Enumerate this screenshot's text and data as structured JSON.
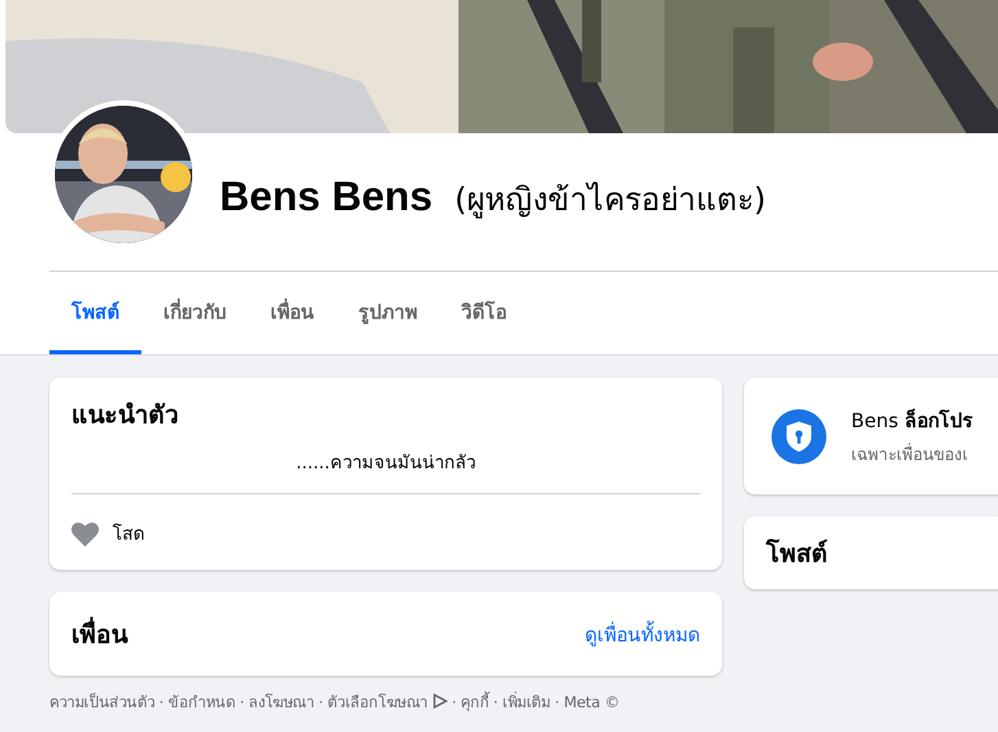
{
  "profile": {
    "name": "Bens Bens",
    "alternate_name": "(ผูหญิงข้าไครอย่าแตะ)"
  },
  "tabs": [
    {
      "label": "โพสต์",
      "selected": true
    },
    {
      "label": "เกี่ยวกับ",
      "selected": false
    },
    {
      "label": "เพื่อน",
      "selected": false
    },
    {
      "label": "รูปภาพ",
      "selected": false
    },
    {
      "label": "วิดีโอ",
      "selected": false
    }
  ],
  "intro": {
    "title": "แนะนำตัว",
    "bio": "......ความจนมันน่ากลัว",
    "relationship": "โสด"
  },
  "friends": {
    "title": "เพื่อน",
    "see_all": "ดูเพื่อนทั้งหมด"
  },
  "footer": {
    "separator": "·",
    "links": [
      {
        "label": "ความเป็นส่วนตัว"
      },
      {
        "label": "ข้อกำหนด"
      },
      {
        "label": "ลงโฆษณา"
      },
      {
        "label": "ตัวเลือกโฆษณา",
        "kind": "adchoices"
      },
      {
        "label": "คุกกี้"
      },
      {
        "label": "เพิ่มเติม"
      },
      {
        "label": "Meta ©",
        "kind": "plain"
      }
    ]
  },
  "locked_notice": {
    "title": "Bens **ล็อกโปร**",
    "subtitle": "เฉพาะเพื่อนของเ"
  },
  "posts": {
    "title": "โพสต์"
  }
}
